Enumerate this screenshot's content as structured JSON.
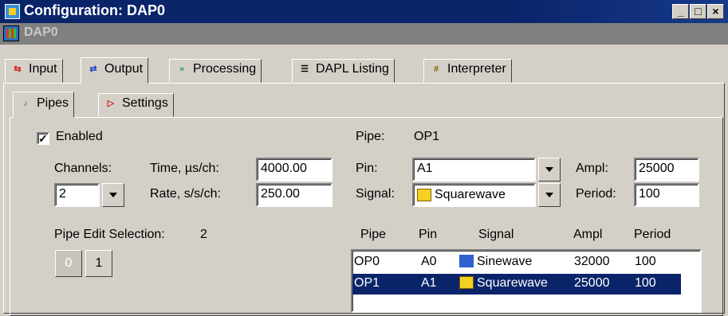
{
  "window": {
    "title": "Configuration: DAP0",
    "doc_name": "DAP0"
  },
  "tabs": [
    {
      "label": "Input",
      "icon": "input-icon"
    },
    {
      "label": "Output",
      "icon": "output-icon"
    },
    {
      "label": "Processing",
      "icon": "processing-icon"
    },
    {
      "label": "DAPL Listing",
      "icon": "listing-icon"
    },
    {
      "label": "Interpreter",
      "icon": "interpreter-icon"
    }
  ],
  "subtabs": [
    {
      "label": "Pipes",
      "icon": "pipes-icon"
    },
    {
      "label": "Settings",
      "icon": "settings-icon"
    }
  ],
  "left": {
    "enabled_label": "Enabled",
    "enabled_checked": true,
    "channels_label": "Channels:",
    "channels_value": "2",
    "time_label": "Time, µs/ch:",
    "time_value": "4000.00",
    "rate_label": "Rate, s/s/ch:",
    "rate_value": "250.00",
    "pipe_edit_label": "Pipe Edit Selection:",
    "pipe_edit_value": "2",
    "pipe_buttons": [
      "0",
      "1"
    ]
  },
  "right": {
    "pipe_label": "Pipe:",
    "pipe_value": "OP1",
    "pin_label": "Pin:",
    "pin_value": "A1",
    "signal_label": "Signal:",
    "signal_value": "Squarewave",
    "ampl_label": "Ampl:",
    "ampl_value": "25000",
    "period_label": "Period:",
    "period_value": "100"
  },
  "table": {
    "headers": [
      "Pipe",
      "Pin",
      "Signal",
      "Ampl",
      "Period"
    ],
    "rows": [
      {
        "pipe": "OP0",
        "pin": "A0",
        "signal": "Sinewave",
        "ampl": "32000",
        "period": "100",
        "selected": false
      },
      {
        "pipe": "OP1",
        "pin": "A1",
        "signal": "Squarewave",
        "ampl": "25000",
        "period": "100",
        "selected": true
      }
    ]
  },
  "colors": {
    "titlebar": "#0a246a",
    "selection": "#0a246a",
    "face": "#d4d0c8"
  }
}
